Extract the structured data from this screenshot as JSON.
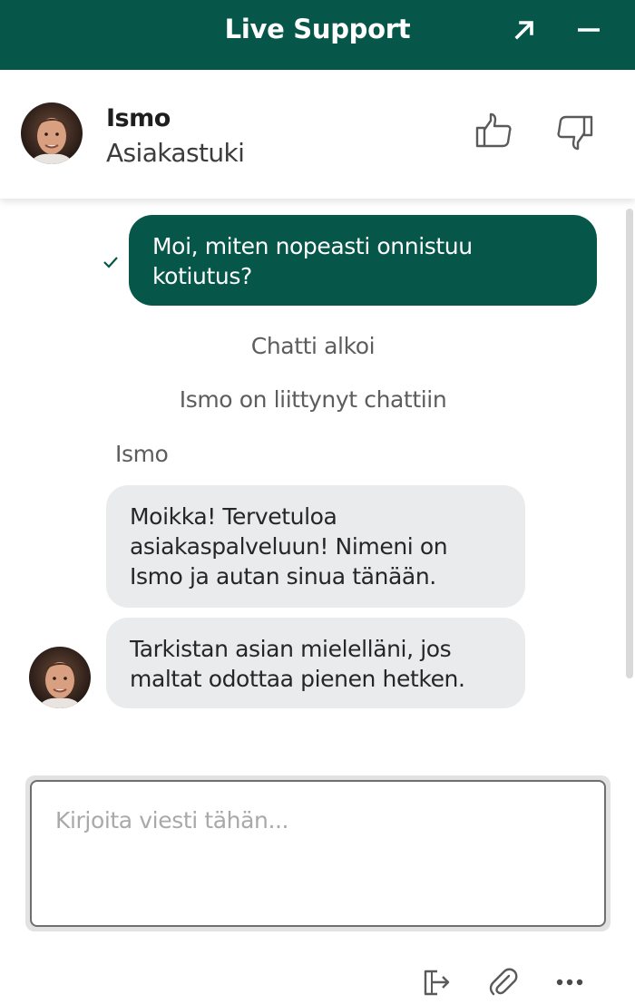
{
  "header": {
    "title": "Live Support",
    "background": "#06574a",
    "popout_icon": "arrow-up-right-icon",
    "minimize_icon": "minus-icon"
  },
  "agent": {
    "name": "Ismo",
    "role": "Asiakastuki",
    "avatar_icon": "agent-avatar",
    "rating": {
      "up_icon": "thumbs-up-icon",
      "down_icon": "thumbs-down-icon"
    }
  },
  "transcript": {
    "messages": [
      {
        "type": "outgoing",
        "text": "Moi, miten nopeasti onnistuu kotiutus?",
        "status_icon": "checkmark-icon"
      },
      {
        "type": "system",
        "text": "Chatti alkoi"
      },
      {
        "type": "system",
        "text": "Ismo on liittynyt chattiin"
      },
      {
        "type": "sender",
        "text": "Ismo"
      },
      {
        "type": "incoming",
        "text": "Moikka! Tervetuloa asiakaspalveluun! Nimeni on Ismo ja autan sinua tänään."
      },
      {
        "type": "incoming",
        "text": "Tarkistan asian mielelläni, jos maltat odottaa pienen hetken."
      }
    ]
  },
  "composer": {
    "placeholder": "Kirjoita viesti tähän...",
    "value": ""
  },
  "toolbar": {
    "end_chat_icon": "exit-icon",
    "attach_icon": "paperclip-icon",
    "more_icon": "more-icon"
  },
  "colors": {
    "accent": "#06574a",
    "incoming_bubble": "#eaebed",
    "system_text": "#5d5d5d"
  }
}
